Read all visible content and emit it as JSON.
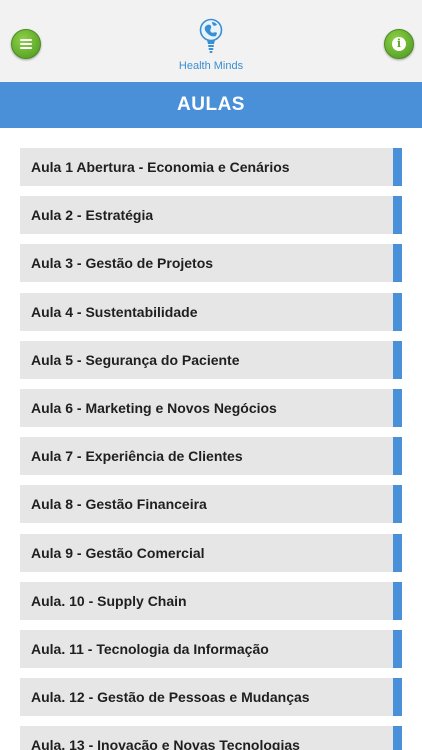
{
  "header": {
    "app_name": "Health Minds",
    "menu_icon": "hamburger-menu-icon",
    "info_icon": "info-icon",
    "brand_color": "#6db33f",
    "logo_color": "#3a8fd3"
  },
  "title_bar": {
    "title": "AULAS",
    "color": "#4a90d9"
  },
  "lessons": [
    {
      "label": "Aula 1 Abertura - Economia e Cenários"
    },
    {
      "label": "Aula 2 - Estratégia"
    },
    {
      "label": "Aula 3 - Gestão de Projetos"
    },
    {
      "label": "Aula 4 - Sustentabilidade"
    },
    {
      "label": "Aula 5 - Segurança do Paciente"
    },
    {
      "label": "Aula 6 - Marketing e Novos Negócios"
    },
    {
      "label": "Aula 7 - Experiência de Clientes"
    },
    {
      "label": "Aula 8 - Gestão Financeira"
    },
    {
      "label": "Aula 9 - Gestão Comercial"
    },
    {
      "label": "Aula. 10 - Supply Chain"
    },
    {
      "label": "Aula. 11 - Tecnologia da Informação"
    },
    {
      "label": "Aula. 12 - Gestão de Pessoas e Mudanças"
    },
    {
      "label": "Aula. 13 - Inovação e Novas Tecnologias"
    }
  ]
}
